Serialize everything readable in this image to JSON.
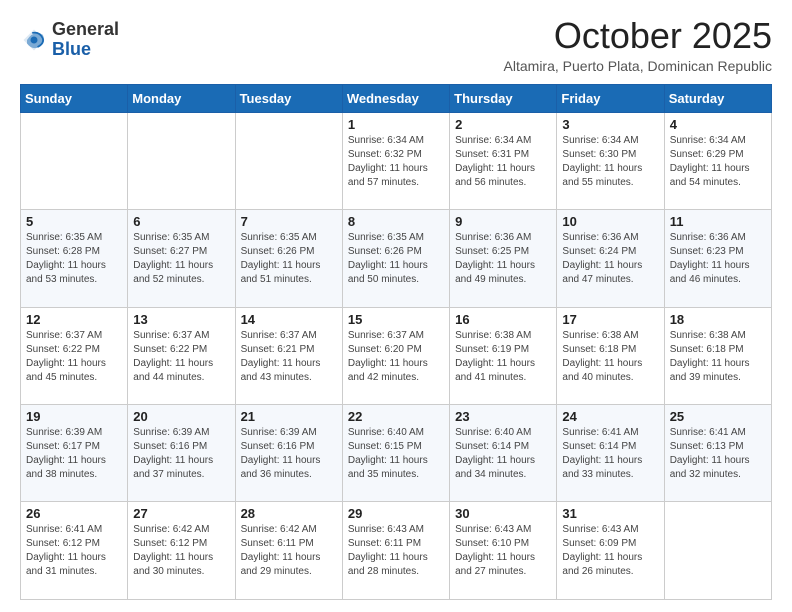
{
  "logo": {
    "general": "General",
    "blue": "Blue"
  },
  "header": {
    "month": "October 2025",
    "location": "Altamira, Puerto Plata, Dominican Republic"
  },
  "days_of_week": [
    "Sunday",
    "Monday",
    "Tuesday",
    "Wednesday",
    "Thursday",
    "Friday",
    "Saturday"
  ],
  "weeks": [
    [
      {
        "day": "",
        "info": ""
      },
      {
        "day": "",
        "info": ""
      },
      {
        "day": "",
        "info": ""
      },
      {
        "day": "1",
        "info": "Sunrise: 6:34 AM\nSunset: 6:32 PM\nDaylight: 11 hours\nand 57 minutes."
      },
      {
        "day": "2",
        "info": "Sunrise: 6:34 AM\nSunset: 6:31 PM\nDaylight: 11 hours\nand 56 minutes."
      },
      {
        "day": "3",
        "info": "Sunrise: 6:34 AM\nSunset: 6:30 PM\nDaylight: 11 hours\nand 55 minutes."
      },
      {
        "day": "4",
        "info": "Sunrise: 6:34 AM\nSunset: 6:29 PM\nDaylight: 11 hours\nand 54 minutes."
      }
    ],
    [
      {
        "day": "5",
        "info": "Sunrise: 6:35 AM\nSunset: 6:28 PM\nDaylight: 11 hours\nand 53 minutes."
      },
      {
        "day": "6",
        "info": "Sunrise: 6:35 AM\nSunset: 6:27 PM\nDaylight: 11 hours\nand 52 minutes."
      },
      {
        "day": "7",
        "info": "Sunrise: 6:35 AM\nSunset: 6:26 PM\nDaylight: 11 hours\nand 51 minutes."
      },
      {
        "day": "8",
        "info": "Sunrise: 6:35 AM\nSunset: 6:26 PM\nDaylight: 11 hours\nand 50 minutes."
      },
      {
        "day": "9",
        "info": "Sunrise: 6:36 AM\nSunset: 6:25 PM\nDaylight: 11 hours\nand 49 minutes."
      },
      {
        "day": "10",
        "info": "Sunrise: 6:36 AM\nSunset: 6:24 PM\nDaylight: 11 hours\nand 47 minutes."
      },
      {
        "day": "11",
        "info": "Sunrise: 6:36 AM\nSunset: 6:23 PM\nDaylight: 11 hours\nand 46 minutes."
      }
    ],
    [
      {
        "day": "12",
        "info": "Sunrise: 6:37 AM\nSunset: 6:22 PM\nDaylight: 11 hours\nand 45 minutes."
      },
      {
        "day": "13",
        "info": "Sunrise: 6:37 AM\nSunset: 6:22 PM\nDaylight: 11 hours\nand 44 minutes."
      },
      {
        "day": "14",
        "info": "Sunrise: 6:37 AM\nSunset: 6:21 PM\nDaylight: 11 hours\nand 43 minutes."
      },
      {
        "day": "15",
        "info": "Sunrise: 6:37 AM\nSunset: 6:20 PM\nDaylight: 11 hours\nand 42 minutes."
      },
      {
        "day": "16",
        "info": "Sunrise: 6:38 AM\nSunset: 6:19 PM\nDaylight: 11 hours\nand 41 minutes."
      },
      {
        "day": "17",
        "info": "Sunrise: 6:38 AM\nSunset: 6:18 PM\nDaylight: 11 hours\nand 40 minutes."
      },
      {
        "day": "18",
        "info": "Sunrise: 6:38 AM\nSunset: 6:18 PM\nDaylight: 11 hours\nand 39 minutes."
      }
    ],
    [
      {
        "day": "19",
        "info": "Sunrise: 6:39 AM\nSunset: 6:17 PM\nDaylight: 11 hours\nand 38 minutes."
      },
      {
        "day": "20",
        "info": "Sunrise: 6:39 AM\nSunset: 6:16 PM\nDaylight: 11 hours\nand 37 minutes."
      },
      {
        "day": "21",
        "info": "Sunrise: 6:39 AM\nSunset: 6:16 PM\nDaylight: 11 hours\nand 36 minutes."
      },
      {
        "day": "22",
        "info": "Sunrise: 6:40 AM\nSunset: 6:15 PM\nDaylight: 11 hours\nand 35 minutes."
      },
      {
        "day": "23",
        "info": "Sunrise: 6:40 AM\nSunset: 6:14 PM\nDaylight: 11 hours\nand 34 minutes."
      },
      {
        "day": "24",
        "info": "Sunrise: 6:41 AM\nSunset: 6:14 PM\nDaylight: 11 hours\nand 33 minutes."
      },
      {
        "day": "25",
        "info": "Sunrise: 6:41 AM\nSunset: 6:13 PM\nDaylight: 11 hours\nand 32 minutes."
      }
    ],
    [
      {
        "day": "26",
        "info": "Sunrise: 6:41 AM\nSunset: 6:12 PM\nDaylight: 11 hours\nand 31 minutes."
      },
      {
        "day": "27",
        "info": "Sunrise: 6:42 AM\nSunset: 6:12 PM\nDaylight: 11 hours\nand 30 minutes."
      },
      {
        "day": "28",
        "info": "Sunrise: 6:42 AM\nSunset: 6:11 PM\nDaylight: 11 hours\nand 29 minutes."
      },
      {
        "day": "29",
        "info": "Sunrise: 6:43 AM\nSunset: 6:11 PM\nDaylight: 11 hours\nand 28 minutes."
      },
      {
        "day": "30",
        "info": "Sunrise: 6:43 AM\nSunset: 6:10 PM\nDaylight: 11 hours\nand 27 minutes."
      },
      {
        "day": "31",
        "info": "Sunrise: 6:43 AM\nSunset: 6:09 PM\nDaylight: 11 hours\nand 26 minutes."
      },
      {
        "day": "",
        "info": ""
      }
    ]
  ]
}
